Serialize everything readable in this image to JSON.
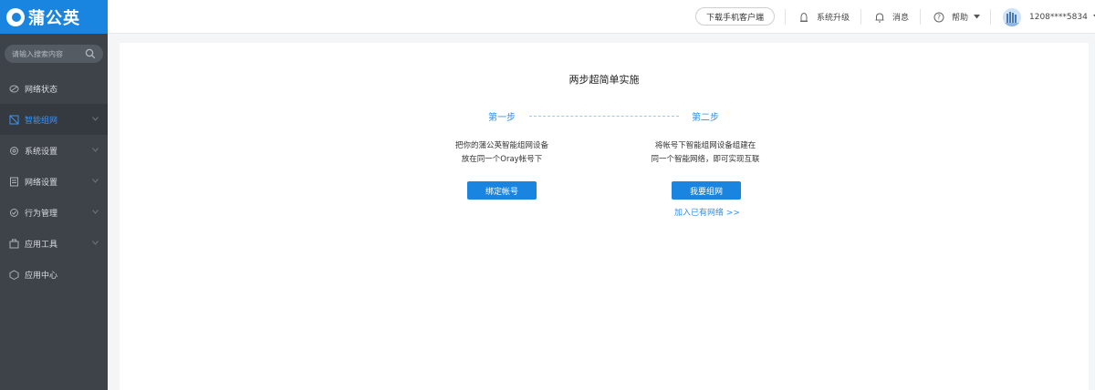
{
  "brand": {
    "name": "蒲公英"
  },
  "search": {
    "placeholder": "请输入搜索内容"
  },
  "sidebar": {
    "items": [
      {
        "label": "网络状态",
        "icon": "network-status-icon",
        "has_chevron": false
      },
      {
        "label": "智能组网",
        "icon": "smart-network-icon",
        "has_chevron": true,
        "active": true
      },
      {
        "label": "系统设置",
        "icon": "gear-icon",
        "has_chevron": true
      },
      {
        "label": "网络设置",
        "icon": "network-settings-icon",
        "has_chevron": true
      },
      {
        "label": "行为管理",
        "icon": "behavior-icon",
        "has_chevron": true
      },
      {
        "label": "应用工具",
        "icon": "toolbox-icon",
        "has_chevron": true
      },
      {
        "label": "应用中心",
        "icon": "app-center-icon",
        "has_chevron": false
      }
    ]
  },
  "topbar": {
    "download_label": "下载手机客户端",
    "upgrade_label": "系统升级",
    "messages_label": "消息",
    "help_label": "帮助",
    "user_label": "1208****5834"
  },
  "main": {
    "title": "两步超简单实施",
    "step1": {
      "label": "第一步",
      "line1": "把你的蒲公英智能组网设备",
      "line2": "放在同一个Oray帐号下",
      "button": "绑定帐号"
    },
    "step2": {
      "label": "第二步",
      "line1": "将帐号下智能组网设备组建在",
      "line2": "同一个智能网络，即可实现互联",
      "button": "我要组网",
      "link": "加入已有网络 >>"
    }
  },
  "colors": {
    "brand": "#1a85e0",
    "sidebar_bg": "#3e4349",
    "accent_text": "#2f8ee8"
  }
}
